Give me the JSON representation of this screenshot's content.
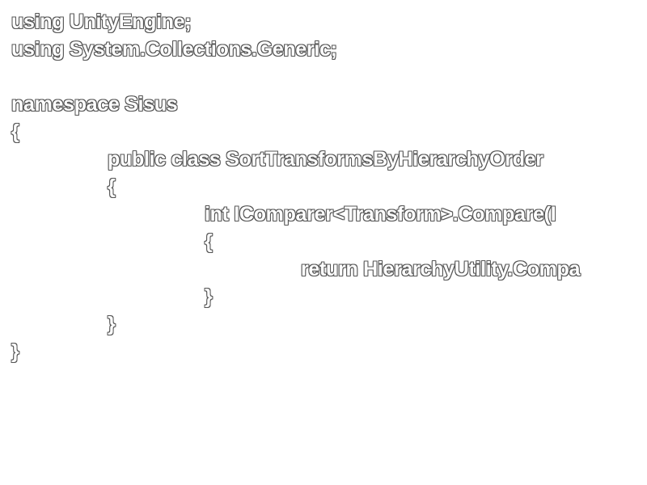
{
  "code": {
    "lines": [
      "using UnityEngine;",
      "using System.Collections.Generic;",
      "",
      "namespace Sisus",
      "{",
      "public class SortTransformsByHierarchyOrder",
      "{",
      "int IComparer<Transform>.Compare(I",
      "{",
      "return HierarchyUtility.Compa",
      "}",
      "}",
      "}"
    ]
  }
}
